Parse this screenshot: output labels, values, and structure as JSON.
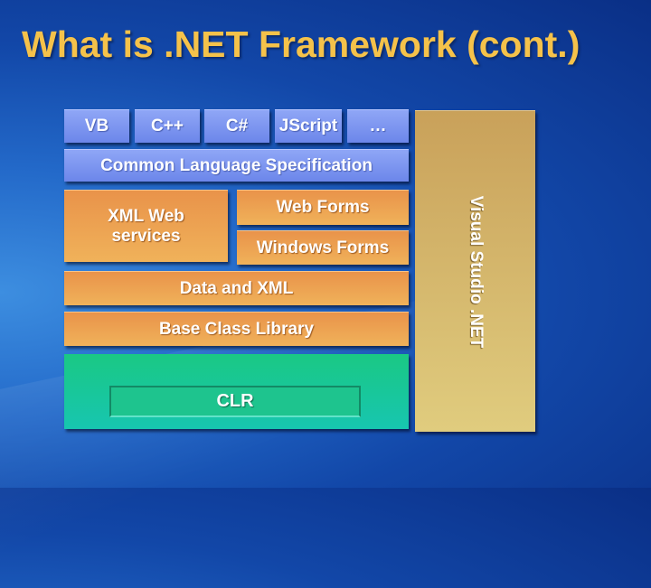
{
  "slide": {
    "title": "What is .NET Framework (cont.)",
    "colors": {
      "title": "#f5c24a",
      "language_layer": "#7f97f0",
      "framework_layer": "#eda050",
      "runtime_layer": "#19c79a",
      "tools_layer": "#d4b66b"
    }
  },
  "diagram": {
    "languages": [
      "VB",
      "C++",
      "C#",
      "JScript",
      "…"
    ],
    "cls": "Common Language Specification",
    "xml_web_services": "XML Web services",
    "web_forms": "Web Forms",
    "windows_forms": "Windows Forms",
    "data_xml": "Data and XML",
    "bcl": "Base Class Library",
    "clr": "CLR",
    "visual_studio": "Visual Studio .NET"
  }
}
